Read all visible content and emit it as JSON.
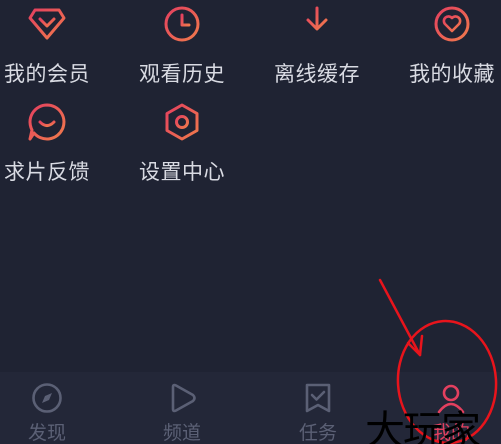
{
  "menu": {
    "items": [
      {
        "label": "我的会员",
        "icon": "diamond-icon"
      },
      {
        "label": "观看历史",
        "icon": "clock-icon"
      },
      {
        "label": "离线缓存",
        "icon": "download-icon"
      },
      {
        "label": "我的收藏",
        "icon": "heart-icon"
      },
      {
        "label": "求片反馈",
        "icon": "chat-bubble-icon"
      },
      {
        "label": "设置中心",
        "icon": "settings-hexagon-icon"
      }
    ]
  },
  "bottom_nav": {
    "items": [
      {
        "label": "发现",
        "icon": "compass-icon",
        "active": false
      },
      {
        "label": "频道",
        "icon": "play-icon",
        "active": false
      },
      {
        "label": "任务",
        "icon": "task-icon",
        "active": false
      },
      {
        "label": "我的",
        "icon": "person-icon",
        "active": true
      }
    ]
  },
  "watermark": {
    "text": "大玩家"
  },
  "colors": {
    "background": "#1f2333",
    "accent": "#e4405f",
    "icon_gradient_end": "#f07a4c",
    "inactive": "#5b6075",
    "annotation": "#e8141c"
  }
}
